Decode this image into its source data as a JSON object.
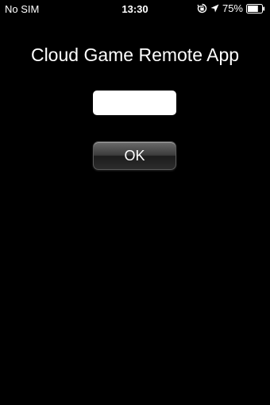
{
  "status_bar": {
    "carrier": "No SIM",
    "time": "13:30",
    "battery_percent": "75%",
    "icons": [
      "rotation-lock-icon",
      "location-arrow-icon",
      "battery-icon"
    ],
    "battery_level": 0.75
  },
  "app": {
    "title": "Cloud Game Remote App",
    "input": {
      "value": "",
      "placeholder": ""
    },
    "ok_label": "OK"
  },
  "colors": {
    "background": "#000000",
    "text": "#ffffff",
    "input_background": "#ffffff"
  }
}
